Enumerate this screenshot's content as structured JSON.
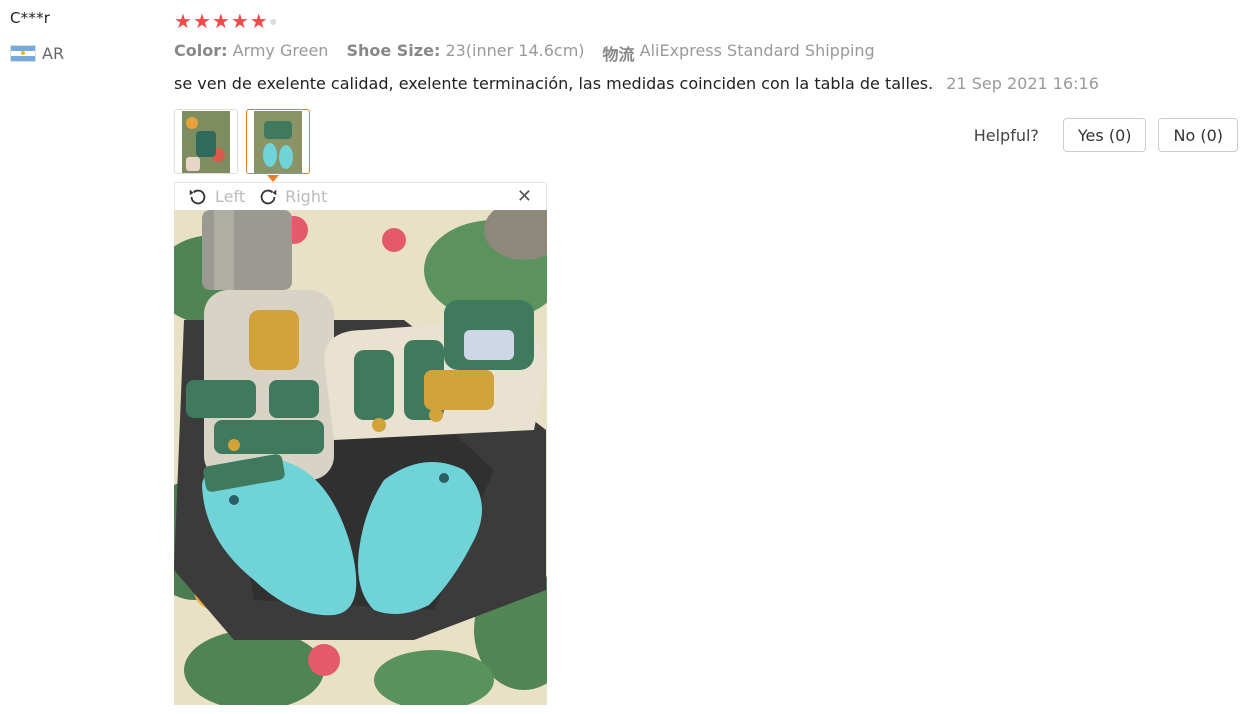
{
  "reviewer": {
    "name": "C***r",
    "country_code": "AR"
  },
  "rating": {
    "stars": 5,
    "max": 5
  },
  "info": {
    "color_label": "Color:",
    "color_value": "Army Green",
    "size_label": "Shoe Size:",
    "size_value": "23(inner 14.6cm)",
    "shipping_label": "物流",
    "shipping_value": "AliExpress Standard Shipping"
  },
  "review": {
    "text": "se ven de exelente calidad, exelente terminación, las medidas coinciden con la tabla de talles.",
    "date": "21 Sep 2021 16:16"
  },
  "helpful": {
    "label": "Helpful?",
    "yes_label": "Yes (0)",
    "no_label": "No (0)"
  },
  "viewer": {
    "left_label": "Left",
    "right_label": "Right",
    "close_glyph": "✕"
  },
  "colors": {
    "star": "#f04b4b",
    "active_thumb": "#e67e22",
    "insole": "#6fd3d8",
    "strap": "#3f7a5e"
  },
  "icons": [
    "argentina-flag-icon",
    "star-icon",
    "rotate-left-icon",
    "rotate-right-icon",
    "close-icon"
  ]
}
